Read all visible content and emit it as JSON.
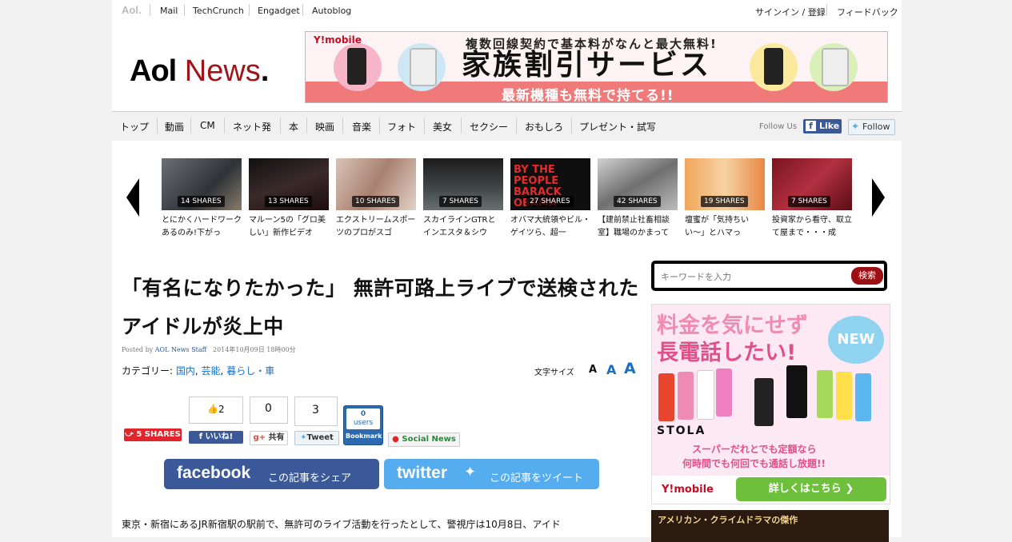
{
  "topbar": {
    "logo": "Aol.",
    "links": [
      "Mail",
      "TechCrunch",
      "Engadget",
      "Autoblog"
    ],
    "signin": "サインイン / 登録",
    "feedback": "フィードバック"
  },
  "header": {
    "brand_aol": "Aol",
    "brand_news": "News",
    "brand_dot": "."
  },
  "banner": {
    "brand": "Y!mobile",
    "line1": "複数回線契約で基本料がなんと最大無料!",
    "line2": "家族割引サービス",
    "line3": "最新機種も無料で持てる!!"
  },
  "nav": {
    "items": [
      "トップ",
      "動画",
      "CM",
      "ネット発",
      "本",
      "映画",
      "音楽",
      "フォト",
      "美女",
      "セクシー",
      "おもしろ",
      "プレゼント・試写"
    ],
    "follow_us": "Follow Us",
    "like": "Like",
    "follow": "Follow"
  },
  "carousel": {
    "cards": [
      {
        "shares": "14 SHARES",
        "caption": "とにかくハードワークあるのみ!下がっ"
      },
      {
        "shares": "13 SHARES",
        "caption": "マルーン5の「グロ美しい」新作ビデオ"
      },
      {
        "shares": "10 SHARES",
        "caption": "エクストリームスポーツのプロがスゴ"
      },
      {
        "shares": "7 SHARES",
        "caption": "スカイラインGTRとインエスタ＆シウ"
      },
      {
        "shares": "27 SHARES",
        "caption": "オバマ大統領やビル・ゲイツら、超一",
        "thumb_text": "BY THE PEOPLE BARACK OBAMA"
      },
      {
        "shares": "42 SHARES",
        "caption": "【建前禁止社畜相談室】職場のかまって"
      },
      {
        "shares": "19 SHARES",
        "caption": "壇蜜が「気持ちいい〜」とハマっ"
      },
      {
        "shares": "7 SHARES",
        "caption": "投資家から看守、取立て屋まで・・・成"
      }
    ]
  },
  "article": {
    "title": "「有名になりたかった」 無許可路上ライブで送検されたアイドルが炎上中",
    "posted_by": "Posted by",
    "author": "AOL News Staff",
    "date": "2014年10月09日 18時00分",
    "category_label": "カテゴリー:",
    "categories": [
      "国内",
      "芸能",
      "暮らし・車"
    ],
    "font_size_label": "文字サイズ",
    "font_letter": "A",
    "body": "東京・新宿にあるJR新宿駅の駅前で、無許可のライブ活動を行ったとして、警視庁は10月8日、アイド"
  },
  "share": {
    "total": "5 SHARES",
    "like_count": "2",
    "gplus_count": "0",
    "tweet_count": "3",
    "hatena_count": "0",
    "hatena_users": "users",
    "like_label": "いいね!",
    "gplus_label": "共有",
    "tweet_label": "Tweet",
    "bookmark_label": "Bookmark",
    "social_news_label": "Social News",
    "fb_brand": "facebook",
    "fb_cta": "この記事をシェア",
    "tw_brand": "twitter",
    "tw_cta": "この記事をツイート"
  },
  "sidebar": {
    "search_placeholder": "キーワードを入力",
    "search_button": "検索",
    "ad_line1": "料金を気にせず",
    "ad_line2": "長電話したい!",
    "ad_new": "NEW",
    "ad_product": "STOLA",
    "ad_promo1": "スーパーだれとでも定額なら",
    "ad_promo2": "何時間でも何回でも通話し放題!!",
    "ad_brand": "Y!mobile",
    "ad_cta": "詳しくはこちら",
    "ad2_text": "アメリカン・クライムドラマの傑作"
  },
  "colors": {
    "brand_red": "#a0141a",
    "facebook": "#3b5998",
    "twitter": "#55acee",
    "link": "#1a6fc0"
  }
}
